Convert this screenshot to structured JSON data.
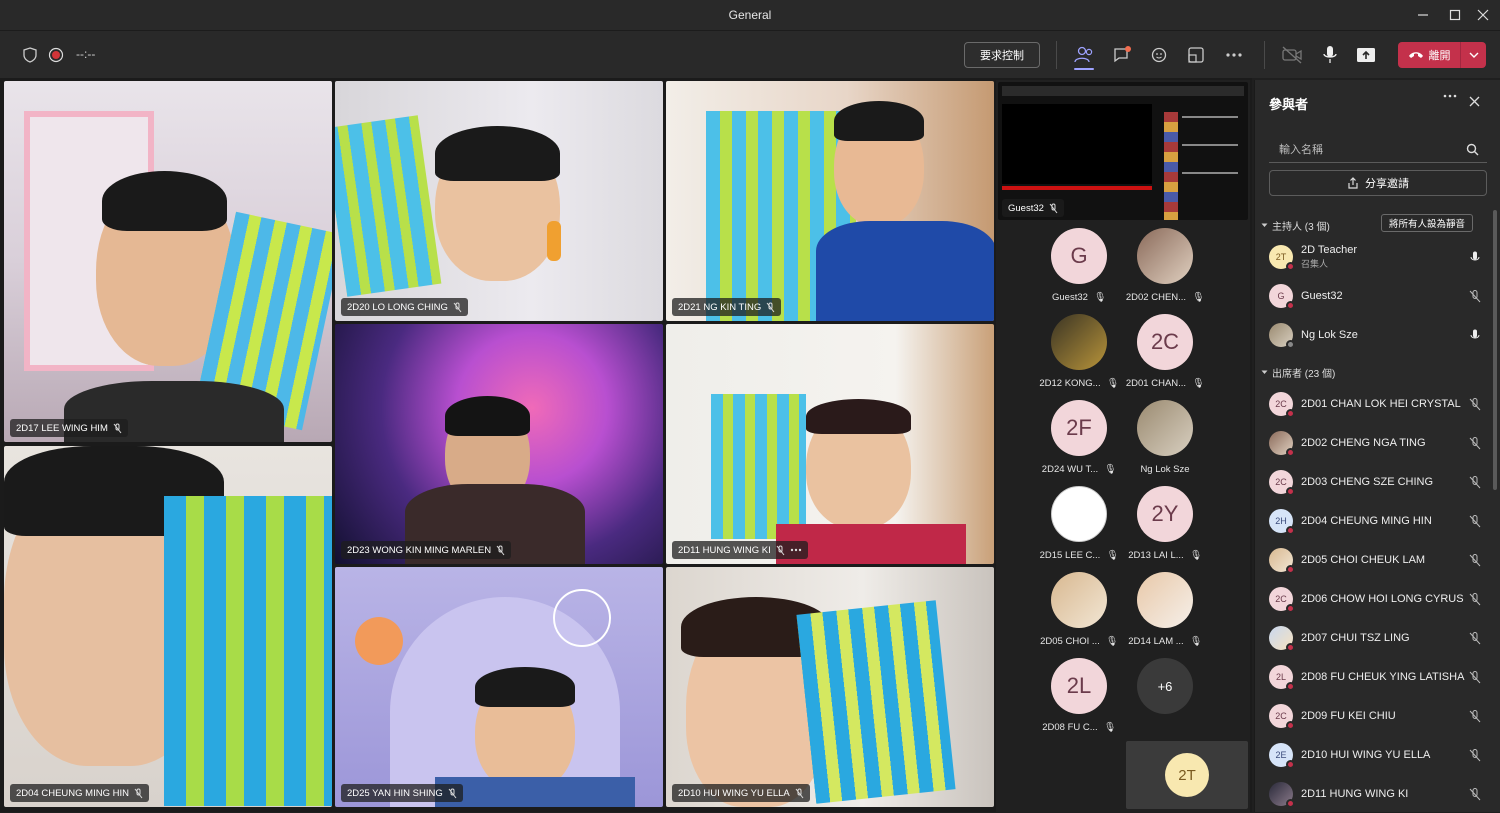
{
  "window": {
    "title": "General"
  },
  "toolbar": {
    "timer": "--:--",
    "request_control": "要求控制",
    "leave": "離開"
  },
  "video_tiles": [
    {
      "name": "2D17 LEE WING HIM"
    },
    {
      "name": "2D20 LO LONG CHING"
    },
    {
      "name": "2D21 NG KIN TING"
    },
    {
      "name": "2D23 WONG KIN MING MARLEN"
    },
    {
      "name": "2D11 HUNG WING KI"
    },
    {
      "name": "2D04 CHEUNG MING HIN"
    },
    {
      "name": "2D25 YAN HIN SHING"
    },
    {
      "name": "2D10 HUI WING YU ELLA"
    }
  ],
  "screen_share": {
    "name": "Guest32"
  },
  "roster": [
    {
      "initials": "G",
      "name": "Guest32"
    },
    {
      "initials": "",
      "name": "2D02 CHEN..."
    },
    {
      "initials": "",
      "name": "2D12 KONG..."
    },
    {
      "initials": "2C",
      "name": "2D01 CHAN..."
    },
    {
      "initials": "2F",
      "name": "2D24 WU T..."
    },
    {
      "initials": "",
      "name": "Ng Lok Sze"
    },
    {
      "initials": "",
      "name": "2D15 LEE C..."
    },
    {
      "initials": "2Y",
      "name": "2D13 LAI L..."
    },
    {
      "initials": "",
      "name": "2D05 CHOI ..."
    },
    {
      "initials": "",
      "name": "2D14 LAM ..."
    },
    {
      "initials": "2L",
      "name": "2D08 FU C..."
    },
    {
      "initials": "+6",
      "name": ""
    }
  ],
  "self_view": {
    "initials": "2T"
  },
  "participants_panel": {
    "title": "參與者",
    "search_placeholder": "輸入名稱",
    "share_invite": "分享邀請",
    "organizers_header": "主持人 (3 個)",
    "mute_all": "將所有人設為靜音",
    "attendees_header": "出席者 (23 個)",
    "organizers": [
      {
        "initials": "2T",
        "name": "2D Teacher",
        "role": "召集人"
      },
      {
        "initials": "G",
        "name": "Guest32",
        "role": ""
      },
      {
        "initials": "",
        "name": "Ng Lok Sze",
        "role": ""
      }
    ],
    "attendees": [
      {
        "initials": "2C",
        "name": "2D01 CHAN LOK HEI CRYSTAL"
      },
      {
        "initials": "",
        "name": "2D02 CHENG NGA TING"
      },
      {
        "initials": "2C",
        "name": "2D03 CHENG SZE CHING"
      },
      {
        "initials": "2H",
        "name": "2D04 CHEUNG MING HIN"
      },
      {
        "initials": "",
        "name": "2D05 CHOI CHEUK LAM"
      },
      {
        "initials": "2C",
        "name": "2D06 CHOW HOI LONG CYRUS"
      },
      {
        "initials": "",
        "name": "2D07 CHUI TSZ LING"
      },
      {
        "initials": "2L",
        "name": "2D08 FU CHEUK YING LATISHA"
      },
      {
        "initials": "2C",
        "name": "2D09 FU KEI CHIU"
      },
      {
        "initials": "2E",
        "name": "2D10 HUI WING YU ELLA"
      },
      {
        "initials": "",
        "name": "2D11 HUNG WING KI"
      }
    ]
  },
  "colors": {
    "leave": "#c4314b",
    "accent": "#6264a7",
    "badge": "#f26d4f"
  }
}
